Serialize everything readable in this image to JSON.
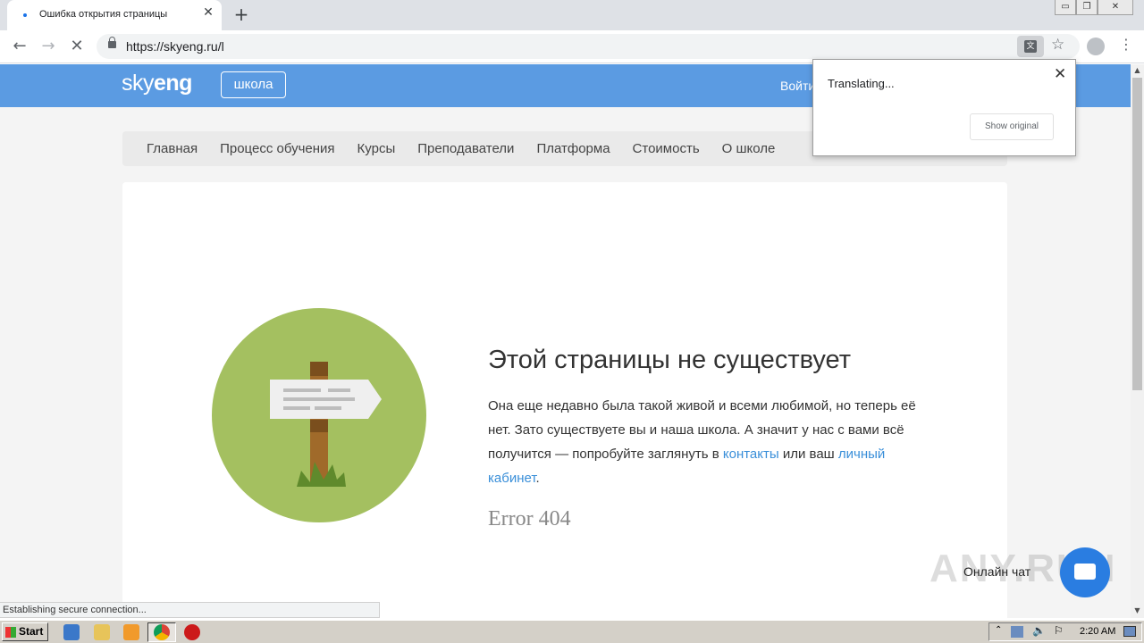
{
  "browser": {
    "tab_title": "Ошибка открытия страницы",
    "tab_close": "✕",
    "new_tab": "+",
    "url": "https://skyeng.ru/l",
    "status_text": "Establishing secure connection..."
  },
  "translate_popup": {
    "title": "Translating...",
    "close": "✕",
    "show_original": "Show original"
  },
  "site": {
    "logo_part1": "sky",
    "logo_part2": "eng",
    "badge": "школа",
    "login": "Войти",
    "nav": [
      "Главная",
      "Процесс обучения",
      "Курсы",
      "Преподаватели",
      "Платформа",
      "Стоимость",
      "О школе"
    ]
  },
  "error": {
    "title": "Этой страницы не существует",
    "text_1": "Она еще недавно была такой живой и всеми любимой, но теперь её нет. Зато существуете вы и наша школа. А значит у нас с вами всё получится — попробуйте заглянуть в ",
    "link_contacts": "контакты",
    "text_2": " или ваш ",
    "link_cabinet": "личный кабинет",
    "text_3": ".",
    "code": "Error 404"
  },
  "chat": {
    "label": "Онлайн чат"
  },
  "watermark": "ANY.RUN",
  "taskbar": {
    "start": "Start",
    "clock": "2:20 AM"
  },
  "colors": {
    "header_blue": "#5b9be2",
    "illustration_green": "#a4c060",
    "link_blue": "#3a8fd9",
    "chat_blue": "#2a7de1"
  }
}
